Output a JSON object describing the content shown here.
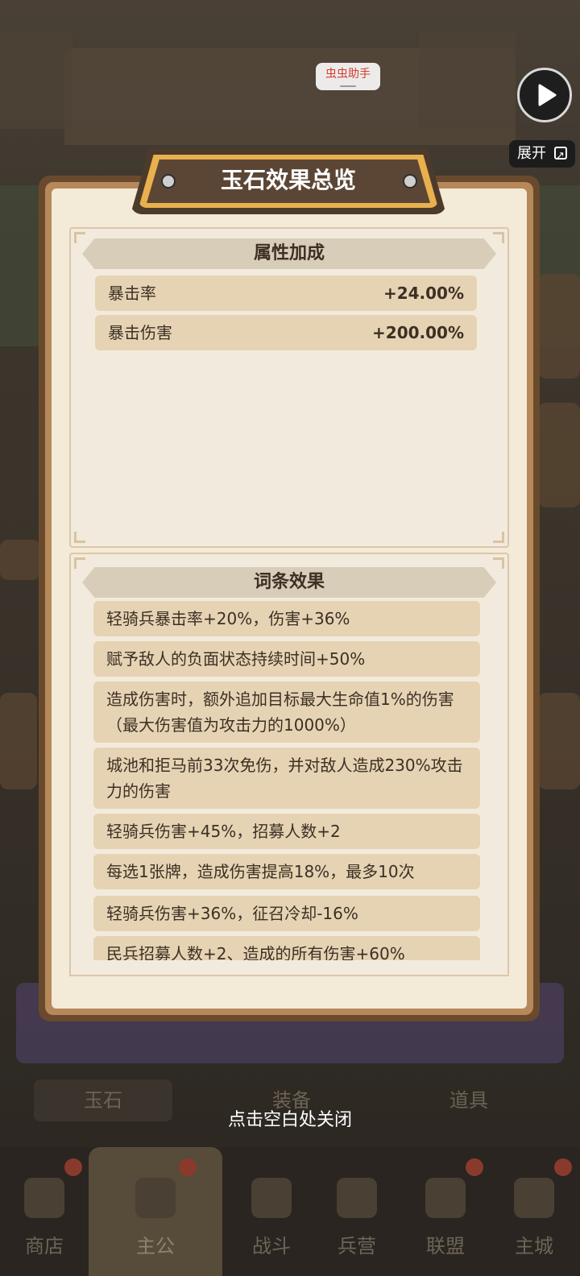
{
  "overlay": {
    "helper_badge": "虫虫助手",
    "expand_label": "展开"
  },
  "panel": {
    "title": "玉石效果总览",
    "attributes": {
      "header": "属性加成",
      "rows": [
        {
          "name": "暴击率",
          "value": "+24.00%"
        },
        {
          "name": "暴击伤害",
          "value": "+200.00%"
        }
      ]
    },
    "effects": {
      "header": "词条效果",
      "items": [
        "轻骑兵暴击率+20%，伤害+36%",
        "赋予敌人的负面状态持续时间+50%",
        "造成伤害时，额外追加目标最大生命值1%的伤害（最大伤害值为攻击力的1000%）",
        "城池和拒马前33次免伤，并对敌人造成230%攻击力的伤害",
        "轻骑兵伤害+45%，招募人数+2",
        "每选1张牌，造成伤害提高18%，最多10次",
        "轻骑兵伤害+36%，征召冷却-16%",
        "民兵招募人数+2、造成的所有伤害+60%"
      ]
    }
  },
  "close_hint": "点击空白处关闭",
  "bottom_tabs": [
    "玉石",
    "装备",
    "道具"
  ],
  "nav": [
    {
      "label": "商店",
      "active": false
    },
    {
      "label": "主公",
      "active": true
    },
    {
      "label": "战斗",
      "active": false
    },
    {
      "label": "兵营",
      "active": false
    },
    {
      "label": "联盟",
      "active": false
    },
    {
      "label": "主城",
      "active": false
    }
  ]
}
